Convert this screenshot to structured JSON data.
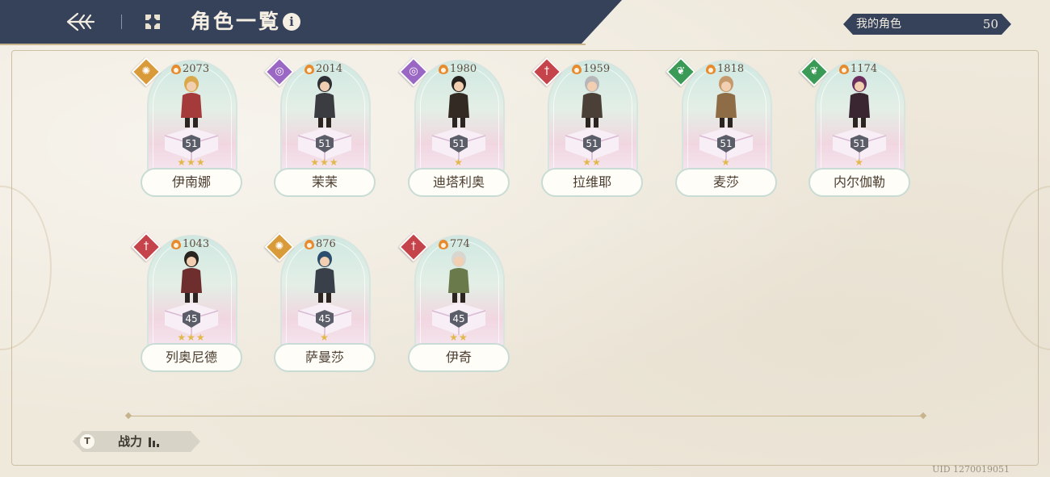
{
  "header": {
    "title": "角色一覧",
    "info_icon": "i"
  },
  "my_characters": {
    "label": "我的角色",
    "count": "50"
  },
  "characters": [
    {
      "name": "伊南娜",
      "power": "2073",
      "level": "51",
      "stars": "★★★",
      "element": "light",
      "element_color": "#d99a3a",
      "element_glyph": "✺"
    },
    {
      "name": "茉茉",
      "power": "2014",
      "level": "51",
      "stars": "★★★",
      "element": "dark",
      "element_color": "#9a68c4",
      "element_glyph": "◎"
    },
    {
      "name": "迪塔利奥",
      "power": "1980",
      "level": "51",
      "stars": "★",
      "element": "dark",
      "element_color": "#9a68c4",
      "element_glyph": "◎"
    },
    {
      "name": "拉维耶",
      "power": "1959",
      "level": "51",
      "stars": "★★",
      "element": "fire",
      "element_color": "#c5434a",
      "element_glyph": "†"
    },
    {
      "name": "麦莎",
      "power": "1818",
      "level": "51",
      "stars": "★",
      "element": "wind",
      "element_color": "#3c9a57",
      "element_glyph": "❦"
    },
    {
      "name": "内尔伽勒",
      "power": "1174",
      "level": "51",
      "stars": "★",
      "element": "wind",
      "element_color": "#3c9a57",
      "element_glyph": "❦"
    },
    {
      "name": "列奥尼德",
      "power": "1043",
      "level": "45",
      "stars": "★★★",
      "element": "fire",
      "element_color": "#c5434a",
      "element_glyph": "†"
    },
    {
      "name": "萨曼莎",
      "power": "876",
      "level": "45",
      "stars": "★",
      "element": "light",
      "element_color": "#d99a3a",
      "element_glyph": "✺"
    },
    {
      "name": "伊奇",
      "power": "774",
      "level": "45",
      "stars": "★★",
      "element": "fire",
      "element_color": "#c5434a",
      "element_glyph": "†"
    }
  ],
  "sort": {
    "icon": "T",
    "label": "战力"
  },
  "uid": "UID 1270019051",
  "icons": {
    "back": "back-arrow-icon",
    "menu": "grid-menu-icon",
    "info": "info-icon",
    "sort": "sort-filter-icon",
    "bars": "bar-chart-icon"
  }
}
